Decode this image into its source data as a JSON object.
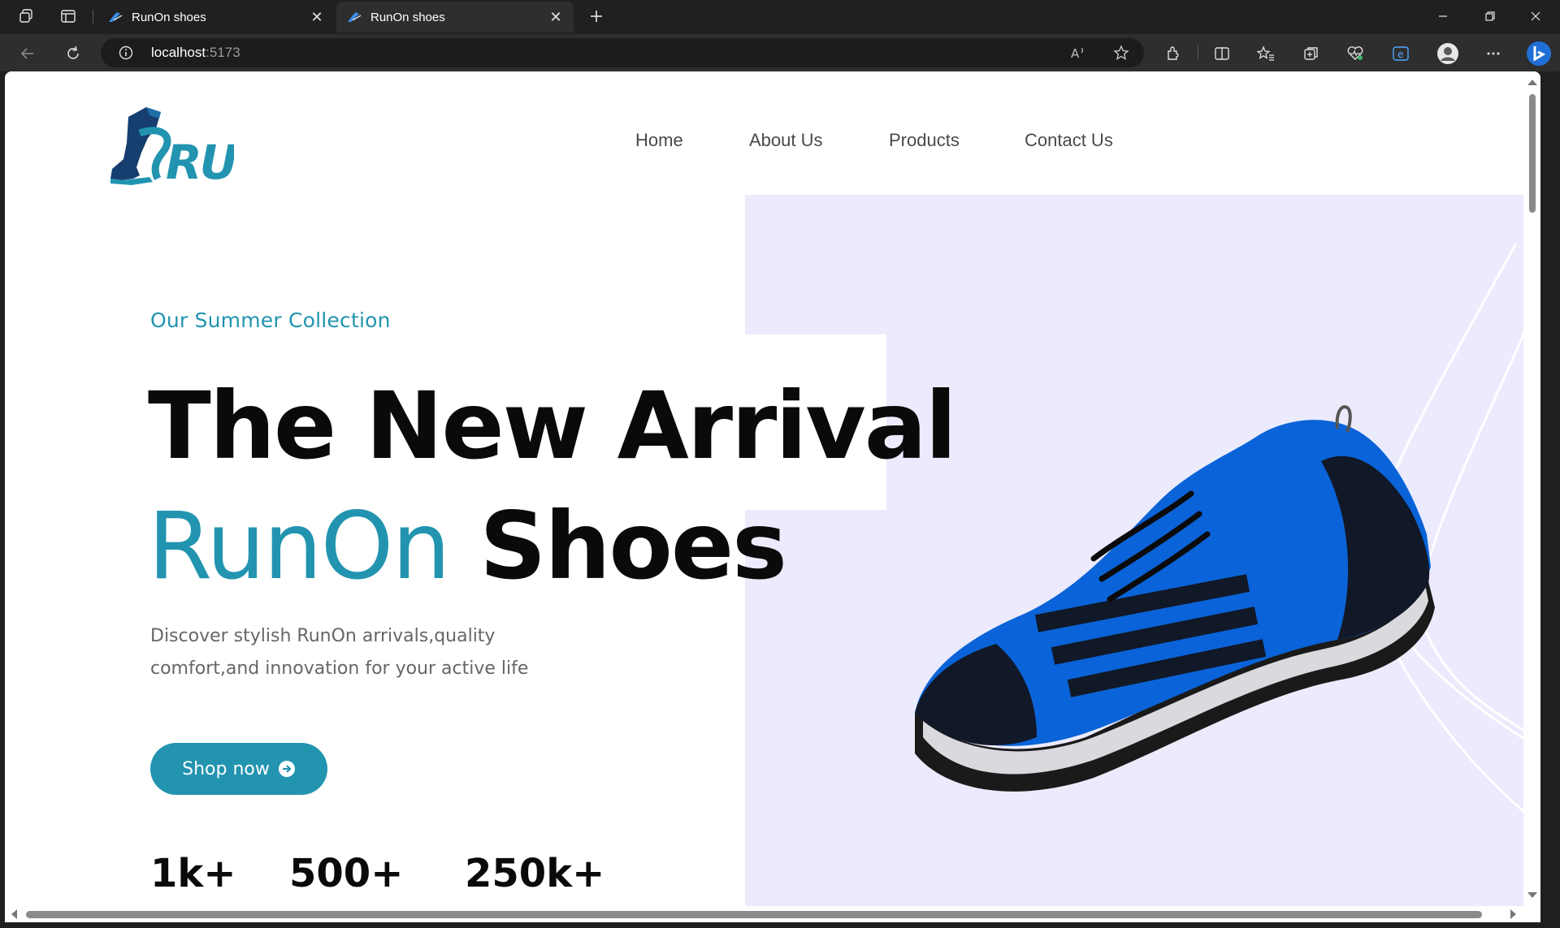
{
  "browser": {
    "tabs": [
      {
        "title": "RunOn shoes",
        "active": false
      },
      {
        "title": "RunOn shoes",
        "active": true
      }
    ],
    "url_host": "localhost",
    "url_port": ":5173"
  },
  "site": {
    "logo_text": "RUN",
    "nav": [
      {
        "label": "Home"
      },
      {
        "label": "About Us"
      },
      {
        "label": "Products"
      },
      {
        "label": "Contact Us"
      }
    ],
    "hero": {
      "eyebrow": "Our Summer Collection",
      "headline_line1": "The New Arrival",
      "headline_brand": "RunOn",
      "headline_rest": "Shoes",
      "description_line1": "Discover stylish RunOn arrivals,quality",
      "description_line2": "comfort,and innovation for your active life",
      "cta_label": "Shop now"
    },
    "stats": [
      {
        "value": "1k+"
      },
      {
        "value": "500+"
      },
      {
        "value": "250k+"
      }
    ]
  },
  "colors": {
    "accent": "#2294b0",
    "hero_bg": "#ebebfd",
    "shoe_blue": "#0a63d8"
  }
}
